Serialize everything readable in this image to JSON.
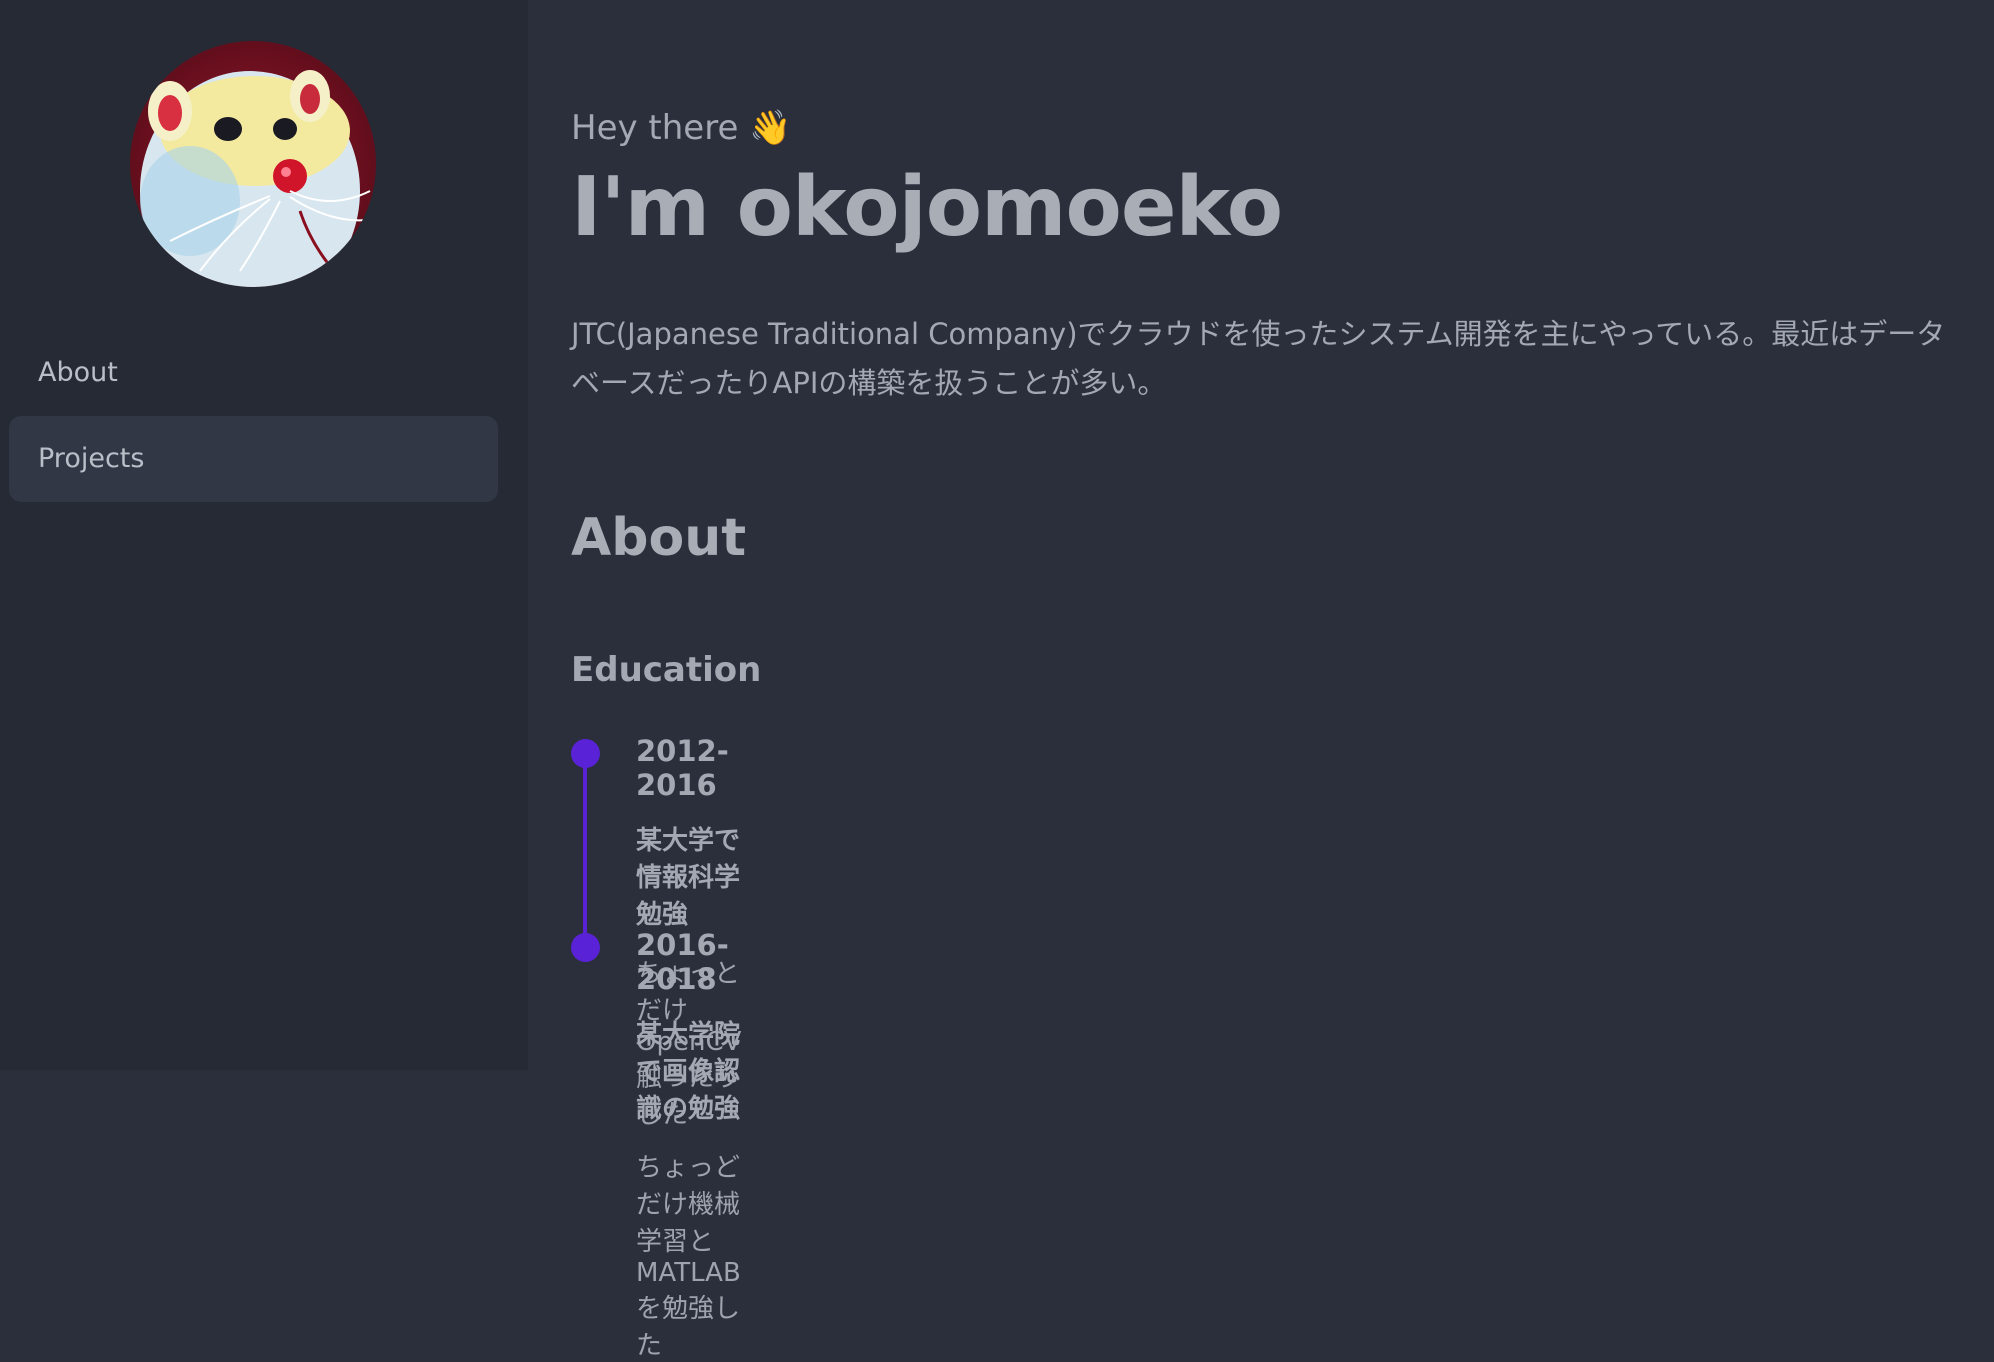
{
  "sidebar": {
    "avatar_alt": "avatar",
    "items": [
      {
        "label": "About",
        "active": false
      },
      {
        "label": "Projects",
        "active": true
      }
    ]
  },
  "hero": {
    "greeting": "Hey there 👋",
    "name": "I'm okojomoeko",
    "intro": "JTC(Japanese Traditional Company)でクラウドを使ったシステム開発を主にやっている。最近はデータベースだったりAPIの構築を扱うことが多い。"
  },
  "about": {
    "title": "About",
    "education_title": "Education",
    "timeline": [
      {
        "years": "2012-2016",
        "title": "某大学で情報科学勉強",
        "desc": "ちょっとだけOpenCV触ったりした"
      },
      {
        "years": "2016-2018",
        "title": "某大学院で画像認識の勉強",
        "desc": "ちょっどだけ機械学習とMATLABを勉強した"
      }
    ]
  },
  "colors": {
    "background": "#2a2f3b",
    "sidebar": "#252a35",
    "nav_active": "#323745",
    "accent": "#5a22d6"
  }
}
